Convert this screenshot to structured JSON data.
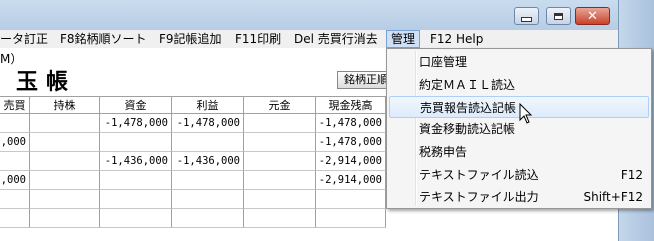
{
  "window": {
    "close_glyph": "✕"
  },
  "menubar": {
    "items": [
      {
        "label": "ータ訂正"
      },
      {
        "label": "F8銘柄順ソート"
      },
      {
        "label": "F9記帳追加"
      },
      {
        "label": "F11印刷"
      },
      {
        "label": "Del 売買行消去"
      },
      {
        "label": "管理"
      },
      {
        "label": "F12 Help"
      }
    ]
  },
  "page": {
    "subtitle": "M）",
    "title": "玉帳",
    "sort_button": "銘柄正順"
  },
  "table": {
    "headers": [
      "売買",
      "持株",
      "資金",
      "利益",
      "元金",
      "現金残高"
    ],
    "rows": [
      [
        "",
        "",
        "-1,478,000",
        "-1,478,000",
        "",
        "-1,478,000"
      ],
      [
        ",000",
        "",
        "",
        "",
        "",
        "-1,478,000"
      ],
      [
        "",
        "",
        "-1,436,000",
        "-1,436,000",
        "",
        "-2,914,000"
      ],
      [
        ",000",
        "",
        "",
        "",
        "",
        "-2,914,000"
      ],
      [
        "",
        "",
        "",
        "",
        "",
        ""
      ],
      [
        "",
        "",
        "",
        "",
        "",
        ""
      ]
    ]
  },
  "dropdown": {
    "items": [
      {
        "label": "口座管理",
        "accel": ""
      },
      {
        "label": "約定ＭＡＩＬ読込",
        "accel": ""
      },
      {
        "label": "売買報告読込記帳",
        "accel": ""
      },
      {
        "label": "資金移動読込記帳",
        "accel": ""
      },
      {
        "label": "税務申告",
        "accel": ""
      },
      {
        "label": "テキストファイル読込",
        "accel": "F12"
      },
      {
        "label": "テキストファイル出力",
        "accel": "Shift+F12"
      }
    ]
  }
}
